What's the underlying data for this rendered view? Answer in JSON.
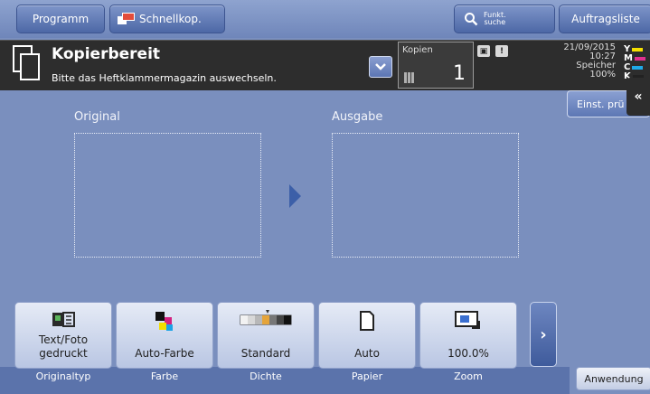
{
  "topbar": {
    "program_label": "Programm",
    "quickcopy_label": "Schnellkop.",
    "function_search_label_line1": "Funkt.",
    "function_search_label_line2": "suche",
    "joblist_label": "Auftragsliste"
  },
  "status": {
    "title": "Kopierbereit",
    "message": "Bitte das Heftklammermagazin auswechseln.",
    "copies_label": "Kopien",
    "copies_value": "1",
    "date": "21/09/2015",
    "time": "10:27",
    "memory_label": "Speicher",
    "memory_value": "100%",
    "toner": [
      {
        "label": "Y",
        "color": "#f5e000"
      },
      {
        "label": "M",
        "color": "#e0308f"
      },
      {
        "label": "C",
        "color": "#1fa9e8"
      },
      {
        "label": "K",
        "color": "#222222"
      }
    ]
  },
  "side": {
    "settings_tab_label": "Einst. prü"
  },
  "main": {
    "original_label": "Original",
    "output_label": "Ausgabe"
  },
  "function_keys": [
    {
      "value": "Text/Foto gedruckt",
      "caption": "Originaltyp",
      "icon": "original-type-icon"
    },
    {
      "value": "Auto-Farbe",
      "caption": "Farbe",
      "icon": "color-icon"
    },
    {
      "value": "Standard",
      "caption": "Dichte",
      "icon": "density-icon"
    },
    {
      "value": "Auto",
      "caption": "Papier",
      "icon": "paper-icon"
    },
    {
      "value": "100.0%",
      "caption": "Zoom",
      "icon": "zoom-icon"
    }
  ],
  "bottom": {
    "application_label": "Anwendung"
  },
  "colors": {
    "background": "#7a8fbe",
    "status_bar": "#2d2d2d",
    "arrow": "#3c5fa8"
  }
}
